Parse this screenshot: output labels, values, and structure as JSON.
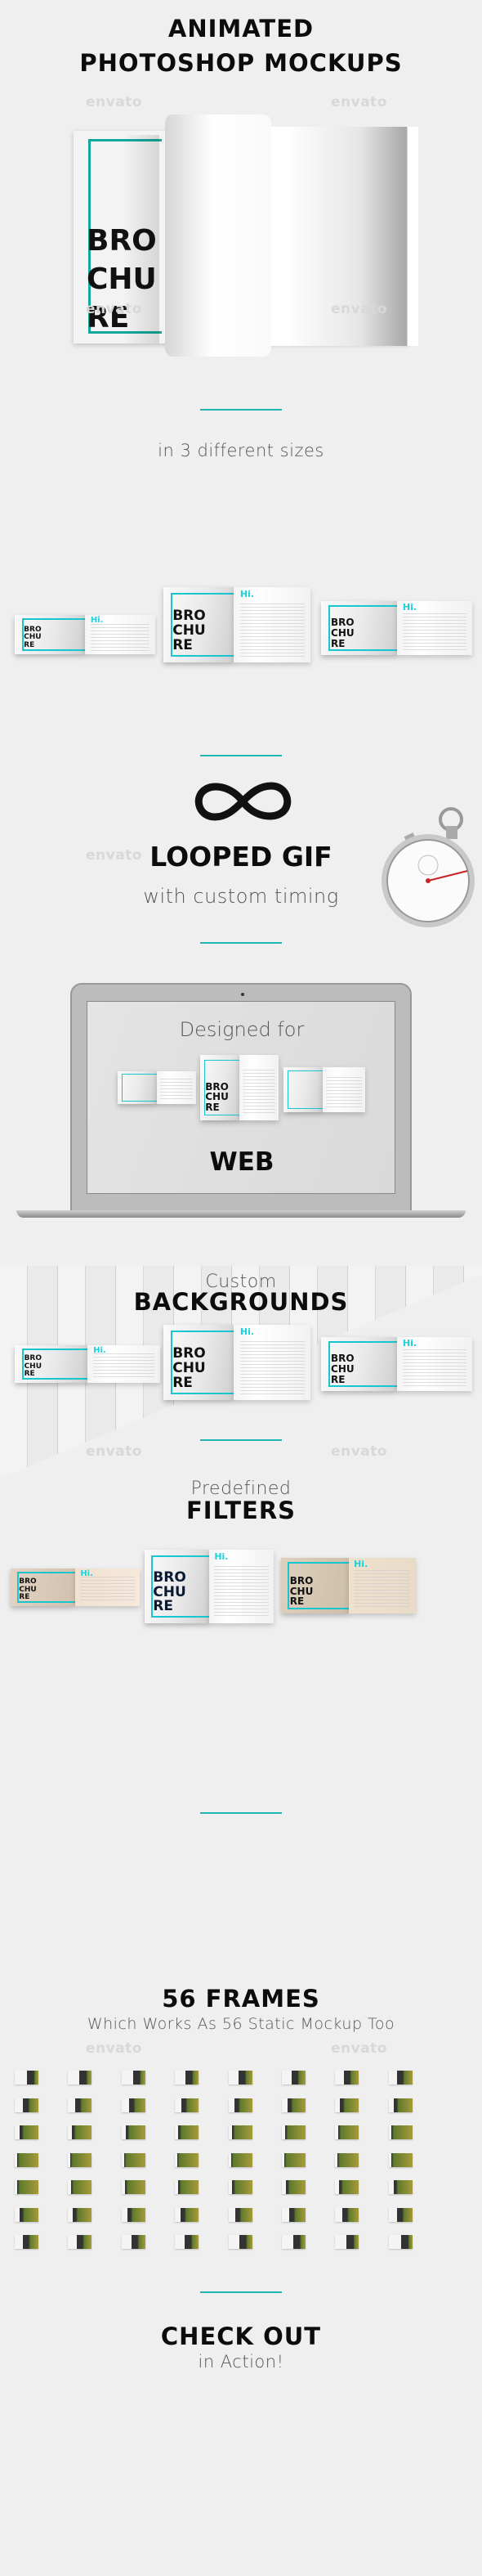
{
  "header": {
    "line1": "ANIMATED",
    "line2": "PHOTOSHOP MOCKUPS"
  },
  "watermark": "envato",
  "brochure": {
    "lines": [
      "BRO",
      "CHU",
      "RE"
    ],
    "hi": "Hi."
  },
  "sizes": {
    "caption": "in 3 different sizes"
  },
  "loop": {
    "icon": "infinity-icon",
    "title": "LOOPED GIF",
    "subtitle": "with custom timing",
    "stopwatch_icon": "stopwatch-icon"
  },
  "web": {
    "pre": "Designed for",
    "title": "WEB"
  },
  "backgrounds": {
    "pre": "Custom",
    "title": "BACKGROUNDS"
  },
  "filters": {
    "pre": "Predefined",
    "title": "FILTERS"
  },
  "frames": {
    "title": "56 FRAMES",
    "subtitle": "Which Works As 56 Static Mockup Too",
    "count": 56,
    "columns": 8
  },
  "cta": {
    "title": "CHECK OUT",
    "subtitle": "in Action!"
  },
  "colors": {
    "accent": "#1cb6b4",
    "brochure_accent": "#19c6cf",
    "background": "#efefef"
  }
}
